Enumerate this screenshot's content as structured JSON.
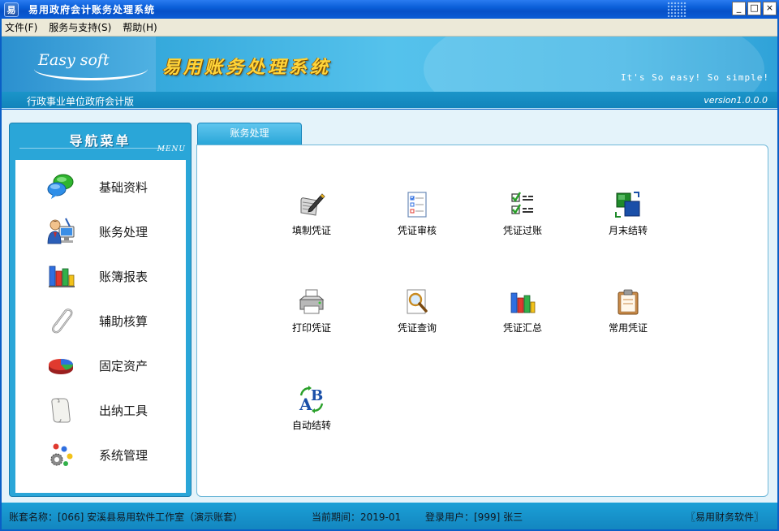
{
  "window": {
    "icon_glyph": "易",
    "title": "易用政府会计账务处理系统",
    "buttons": [
      "_",
      "□",
      "×"
    ]
  },
  "menu": [
    {
      "label": "文件(F)"
    },
    {
      "label": "服务与支持(S)"
    },
    {
      "label": "帮助(H)"
    }
  ],
  "banner": {
    "logo": "Easy soft",
    "system_name": "易用账务处理系统",
    "slogan": "It's So easy! So simple!",
    "edition": "行政事业单位政府会计版",
    "version": "version1.0.0.0"
  },
  "nav": {
    "title": "导航菜单",
    "subtitle": "MENU",
    "items": [
      {
        "label": "基础资料",
        "icon": "chat-bubbles-icon"
      },
      {
        "label": "账务处理",
        "icon": "user-computer-icon"
      },
      {
        "label": "账簿报表",
        "icon": "bar-chart-icon"
      },
      {
        "label": "辅助核算",
        "icon": "paperclip-icon"
      },
      {
        "label": "固定资产",
        "icon": "pie-chart-icon"
      },
      {
        "label": "出纳工具",
        "icon": "scroll-icon"
      },
      {
        "label": "系统管理",
        "icon": "gears-icon"
      }
    ]
  },
  "tab": {
    "label": "账务处理"
  },
  "functions": [
    {
      "label": "填制凭证",
      "icon": "pen-document-icon"
    },
    {
      "label": "凭证审核",
      "icon": "checklist-document-icon"
    },
    {
      "label": "凭证过账",
      "icon": "check-list-icon"
    },
    {
      "label": "月末结转",
      "icon": "transfer-squares-icon"
    },
    {
      "label": "打印凭证",
      "icon": "printer-icon"
    },
    {
      "label": "凭证查询",
      "icon": "magnifier-document-icon"
    },
    {
      "label": "凭证汇总",
      "icon": "summary-chart-icon"
    },
    {
      "label": "常用凭证",
      "icon": "clipboard-icon"
    },
    {
      "label": "自动结转",
      "icon": "ab-convert-icon"
    }
  ],
  "status": {
    "account": "账套名称：[066] 安溪县易用软件工作室（演示账套）",
    "period": "当前期间：2019-01",
    "user": "登录用户：[999] 张三",
    "brand": "〖易用财务软件〗"
  },
  "colors": {
    "titlebar": "#0a5fd8",
    "banner": "#35a9dc",
    "nav_panel": "#2aa6d8",
    "system_name": "#ffd53a",
    "status_bar": "#1386c0"
  }
}
